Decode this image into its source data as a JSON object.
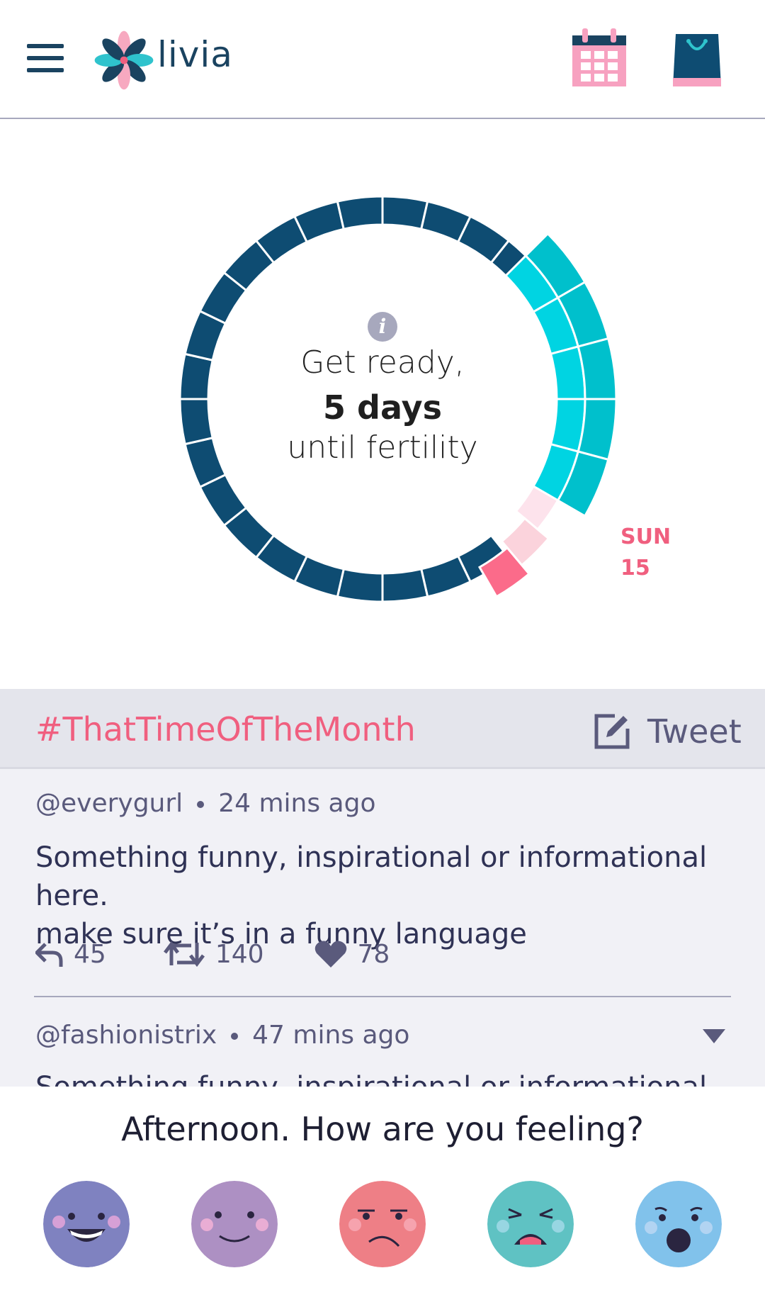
{
  "app": {
    "brand": "livia"
  },
  "header": {
    "menu_icon": "hamburger-menu-icon",
    "calendar_icon": "calendar-icon",
    "bag_icon": "shopping-bag-icon"
  },
  "cycle": {
    "status_line1": "Get ready,",
    "status_line2": "5 days",
    "status_line3": "until fertility",
    "marker_day": "SUN",
    "marker_date": "15",
    "colors": {
      "base": "#0e4c72",
      "fertile": "#00d4e2",
      "fertile_outer": "#00c0cc",
      "period_light": "#fde3ec",
      "period_mid": "#fbd3dc",
      "today": "#fb6b8a"
    }
  },
  "feed": {
    "hashtag": "#ThatTimeOfTheMonth",
    "tweet_label": "Tweet",
    "posts": [
      {
        "handle": "@everygurl",
        "time": "24 mins ago",
        "text1": "Something funny, inspirational or informational here.",
        "text2": "make sure it’s in a funny language",
        "replies": "45",
        "retweets": "140",
        "likes": "78"
      },
      {
        "handle": "@fashionistrix",
        "time": "47 mins ago",
        "text1": "Something funny, inspirational or informational here."
      }
    ]
  },
  "mood": {
    "question": "Afternoon. How are you feeling?",
    "faces": [
      {
        "name": "happy-face-icon",
        "color": "#7f82c0"
      },
      {
        "name": "content-face-icon",
        "color": "#ad90c3"
      },
      {
        "name": "annoyed-face-icon",
        "color": "#ee7f86"
      },
      {
        "name": "distressed-face-icon",
        "color": "#5fc2c3"
      },
      {
        "name": "shocked-face-icon",
        "color": "#81c2eb"
      }
    ]
  }
}
